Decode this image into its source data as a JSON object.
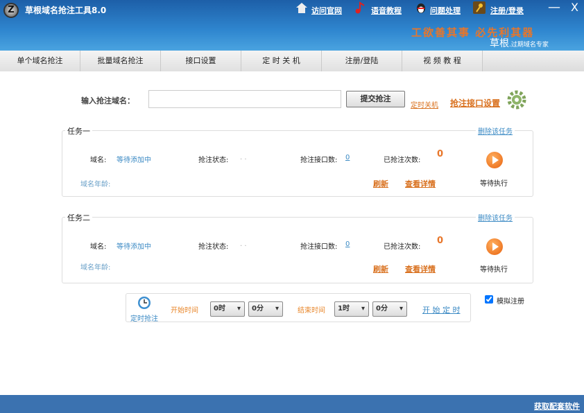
{
  "app": {
    "title": "草根域名抢注工具8.0",
    "logo_letter": "Z"
  },
  "toplinks": [
    {
      "label": "访问官网",
      "icon": "home-icon"
    },
    {
      "label": "语音教程",
      "icon": "music-note-icon"
    },
    {
      "label": "问题处理",
      "icon": "penguin-icon"
    },
    {
      "label": "注册/登录",
      "icon": "key-icon"
    }
  ],
  "window": {
    "minimize": "—",
    "close": "X"
  },
  "banner": {
    "slogan": "工欲善其事 必先利其器",
    "brand": "草根",
    "brand_sub": ".过期域名专家"
  },
  "nav": [
    "单个域名抢注",
    "批量域名抢注",
    "接口设置",
    "定 时 关 机",
    "注册/登陆",
    "视 频 教 程"
  ],
  "form": {
    "label": "输入抢注域名：",
    "value": "",
    "submit": "提交抢注",
    "shutdown_link": "定时关机",
    "settings_link": "抢注接口设置"
  },
  "tasks": [
    {
      "title": "任务一",
      "delete": "删除该任务",
      "domain_label": "域名:",
      "domain_value": "等待添加中",
      "status_label": "抢注状态:",
      "status_value": ". .",
      "api_label": "抢注接口数:",
      "api_value": "0",
      "count_label": "已抢注次数:",
      "count_value": "0",
      "age_label": "域名年龄:",
      "refresh": "刷新",
      "details": "查看详情",
      "run_status": "等待执行"
    },
    {
      "title": "任务二",
      "delete": "删除该任务",
      "domain_label": "域名:",
      "domain_value": "等待添加中",
      "status_label": "抢注状态:",
      "status_value": ". .",
      "api_label": "抢注接口数:",
      "api_value": "0",
      "count_label": "已抢注次数:",
      "count_value": "0",
      "age_label": "域名年龄:",
      "refresh": "刷新",
      "details": "查看详情",
      "run_status": "等待执行"
    }
  ],
  "timer": {
    "label": "定时抢注",
    "start_label": "开始时间",
    "start_hour": "0时",
    "start_min": "0分",
    "end_label": "结束时间",
    "end_hour": "1时",
    "end_min": "0分",
    "start_button": "开 始 定 时"
  },
  "simulate": {
    "label": "模拟注册",
    "checked": true
  },
  "footer": {
    "link": "获取配套软件"
  }
}
